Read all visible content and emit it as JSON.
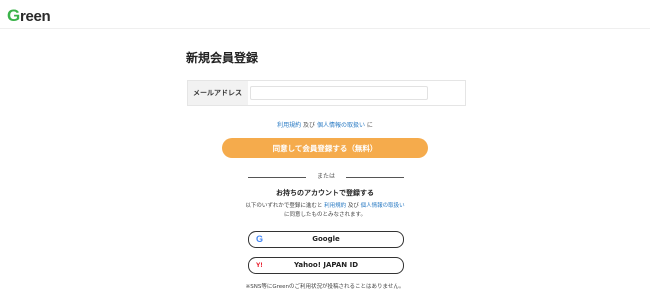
{
  "header": {
    "logo_first": "G",
    "logo_rest": "reen"
  },
  "page": {
    "title": "新規会員登録"
  },
  "form": {
    "email_label": "メールアドレス",
    "email_value": "",
    "email_placeholder": ""
  },
  "terms": {
    "terms_link": "利用規約",
    "and": "及び",
    "privacy_link": "個人情報の取扱い",
    "suffix": "に"
  },
  "register_button": {
    "label": "同意して会員登録する（無料）"
  },
  "divider": {
    "label": "または"
  },
  "social": {
    "title": "お持ちのアカウントで登録する",
    "note_prefix": "以下のいずれかで登録に進むと",
    "note_terms_link": "利用規約",
    "note_and": "及び",
    "note_privacy_link": "個人情報の取扱い",
    "note_suffix": "に同意したものとみなされます。",
    "google_label": "Google",
    "google_icon_glyph": "G",
    "yahoo_label": "Yahoo! JAPAN ID",
    "yahoo_icon_glyph": "Y!",
    "bottom_note": "※SNS等にGreenのご利用状況が投稿されることはありません。"
  },
  "colors": {
    "brand_green": "#3bb34a",
    "accent_orange": "#f5ab4c",
    "link_blue": "#2a7bc4",
    "yahoo_red": "#e60012"
  },
  "icons": {
    "google": "google-icon",
    "yahoo": "yahoo-icon"
  }
}
